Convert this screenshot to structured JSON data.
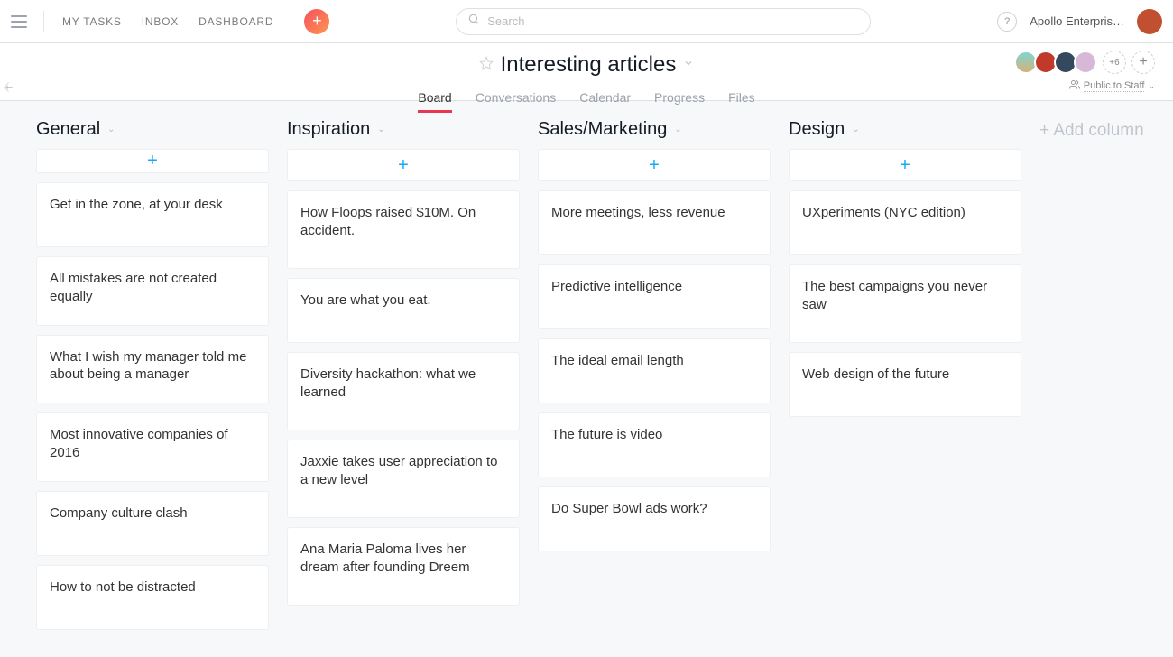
{
  "topbar": {
    "nav": [
      "MY TASKS",
      "INBOX",
      "DASHBOARD"
    ],
    "search_placeholder": "Search",
    "workspace": "Apollo Enterpris…",
    "help": "?"
  },
  "project": {
    "title": "Interesting articles",
    "tabs": [
      "Board",
      "Conversations",
      "Calendar",
      "Progress",
      "Files"
    ],
    "active_tab": 0,
    "member_overflow": "+6",
    "privacy": "Public to Staff"
  },
  "columns": [
    {
      "title": "General",
      "cards": [
        "Get in the zone, at your desk",
        "All mistakes are not created equally",
        "What I wish my manager told me about being a manager",
        "Most innovative companies of 2016",
        "Company culture clash",
        "How to not be distracted"
      ]
    },
    {
      "title": "Inspiration",
      "cards": [
        "How Floops raised $10M. On accident.",
        "You are what you eat.",
        "Diversity hackathon: what we learned",
        "Jaxxie takes user appreciation to a new level",
        "Ana Maria Paloma lives her dream after founding Dreem"
      ]
    },
    {
      "title": "Sales/Marketing",
      "cards": [
        "More meetings, less revenue",
        "Predictive intelligence",
        "The ideal email length",
        "The future is video",
        "Do Super Bowl ads work?"
      ]
    },
    {
      "title": "Design",
      "cards": [
        "UXperiments (NYC edition)",
        "The best campaigns you never saw",
        "Web design of the future"
      ]
    }
  ],
  "add_column": "+ Add column"
}
